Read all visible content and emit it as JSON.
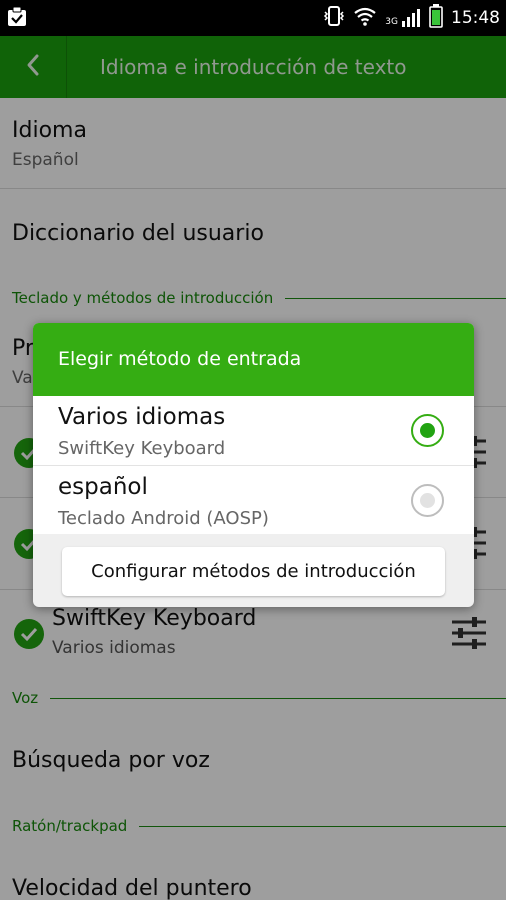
{
  "status_bar": {
    "time": "15:48",
    "network": "3G"
  },
  "action_bar": {
    "title": "Idioma e introducción de texto"
  },
  "settings": {
    "language": {
      "title": "Idioma",
      "summary": "Español"
    },
    "user_dictionary": {
      "title": "Diccionario del usuario"
    },
    "keyboard_category": "Teclado y métodos de introducción",
    "default_partial": {
      "title": "Pr",
      "summary": "Va"
    },
    "ime_items": [
      {
        "title": "SwiftKey Keyboard",
        "summary": "Varios idiomas",
        "checked": true
      }
    ],
    "voice_category": "Voz",
    "voice_search": {
      "title": "Búsqueda por voz"
    },
    "pointer_category": "Ratón/trackpad",
    "pointer_speed": {
      "title": "Velocidad del puntero"
    }
  },
  "dialog": {
    "title": "Elegir método de entrada",
    "options": [
      {
        "title": "Varios idiomas",
        "subtitle": "SwiftKey Keyboard",
        "selected": true
      },
      {
        "title": "español",
        "subtitle": "Teclado Android (AOSP)",
        "selected": false
      }
    ],
    "button_label": "Configurar métodos de introducción"
  },
  "colors": {
    "accent": "#1aa10e",
    "dialog_header": "#35ad13",
    "category_text": "#17880c"
  }
}
